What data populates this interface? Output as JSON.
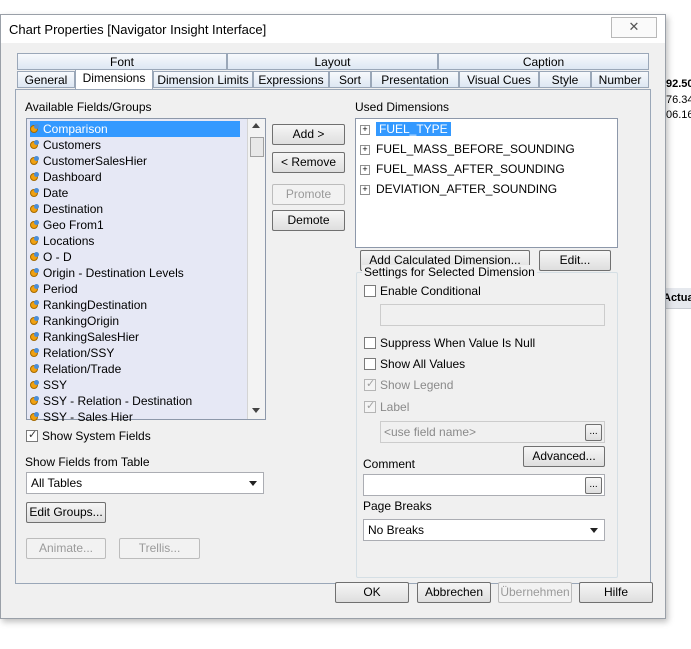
{
  "background_table": {
    "header_cell": "Actua",
    "values": [
      "92.50",
      "76.34",
      "06.16"
    ]
  },
  "window": {
    "title": "Chart Properties [Navigator Insight Interface]",
    "close_glyph": "✕"
  },
  "tabs_top": [
    "Font",
    "Layout",
    "Caption"
  ],
  "tabs_bottom": [
    "General",
    "Dimensions",
    "Dimension Limits",
    "Expressions",
    "Sort",
    "Presentation",
    "Visual Cues",
    "Style",
    "Number"
  ],
  "active_tab": "Dimensions",
  "available": {
    "label": "Available Fields/Groups",
    "items": [
      "Comparison",
      "Customers",
      "CustomerSalesHier",
      "Dashboard",
      "Date",
      "Destination",
      "Geo From1",
      "Locations",
      "O - D",
      "Origin - Destination Levels",
      "Period",
      "RankingDestination",
      "RankingOrigin",
      "RankingSalesHier",
      "Relation/SSY",
      "Relation/Trade",
      "SSY",
      "SSY - Relation - Destination",
      "SSY - Sales Hier"
    ],
    "selected": "Comparison"
  },
  "show_system_fields": {
    "label": "Show System Fields",
    "checked": true
  },
  "show_fields_from_table": {
    "label": "Show Fields from Table",
    "value": "All Tables"
  },
  "buttons": {
    "add": "Add >",
    "remove": "< Remove",
    "promote": "Promote",
    "demote": "Demote",
    "edit_groups": "Edit Groups...",
    "animate": "Animate...",
    "trellis": "Trellis...",
    "add_calculated": "Add Calculated Dimension...",
    "edit": "Edit...",
    "advanced": "Advanced...",
    "ellipsis": "...",
    "ok": "OK",
    "cancel": "Abbrechen",
    "apply": "Übernehmen",
    "help": "Hilfe"
  },
  "used": {
    "label": "Used Dimensions",
    "items": [
      "FUEL_TYPE",
      "FUEL_MASS_BEFORE_SOUNDING",
      "FUEL_MASS_AFTER_SOUNDING",
      "DEVIATION_AFTER_SOUNDING"
    ],
    "selected": "FUEL_TYPE",
    "expander": "+"
  },
  "settings": {
    "group_label": "Settings for Selected Dimension",
    "enable_conditional": {
      "label": "Enable Conditional",
      "checked": false
    },
    "suppress_null": {
      "label": "Suppress When Value Is Null",
      "checked": false
    },
    "show_all_values": {
      "label": "Show All Values",
      "checked": false
    },
    "show_legend": {
      "label": "Show Legend",
      "checked": true,
      "disabled": true
    },
    "label_cb": {
      "label": "Label",
      "checked": true,
      "disabled": true
    },
    "label_placeholder": "<use field name>",
    "comment_label": "Comment",
    "page_breaks_label": "Page Breaks",
    "page_breaks_value": "No Breaks"
  },
  "check_glyph": "✓"
}
